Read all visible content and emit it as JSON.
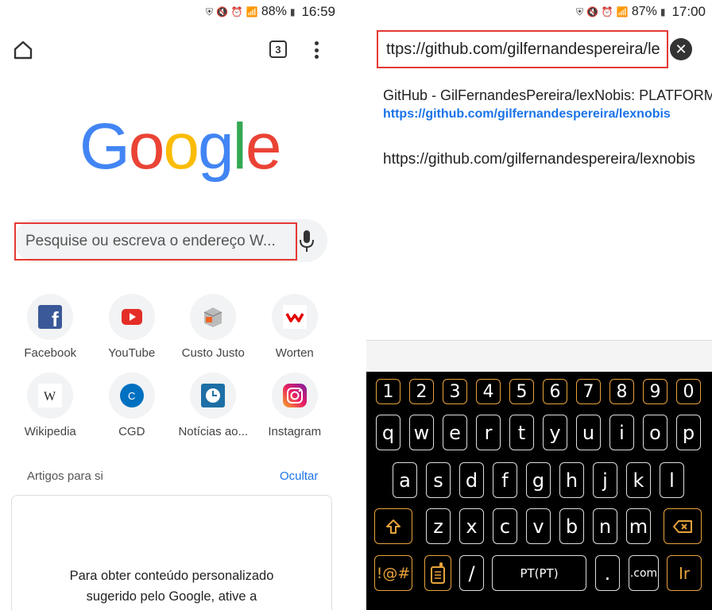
{
  "left": {
    "status": {
      "battery": "88%",
      "time": "16:59"
    },
    "tab_count": "3",
    "logo": [
      "G",
      "o",
      "o",
      "g",
      "l",
      "e"
    ],
    "logo_colors": [
      "#4285F4",
      "#EA4335",
      "#FBBC05",
      "#4285F4",
      "#34A853",
      "#EA4335"
    ],
    "search": {
      "placeholder": "Pesquise ou escreva o endereço W..."
    },
    "shortcuts": [
      {
        "label": "Facebook",
        "icon": "facebook-icon"
      },
      {
        "label": "YouTube",
        "icon": "youtube-icon"
      },
      {
        "label": "Custo Justo",
        "icon": "custo-justo-icon"
      },
      {
        "label": "Worten",
        "icon": "worten-icon"
      },
      {
        "label": "Wikipedia",
        "icon": "wikipedia-icon"
      },
      {
        "label": "CGD",
        "icon": "cgd-icon"
      },
      {
        "label": "Notícias ao...",
        "icon": "clock-icon"
      },
      {
        "label": "Instagram",
        "icon": "instagram-icon"
      }
    ],
    "articles_label": "Artigos para si",
    "hide_label": "Ocultar",
    "card_text_1": "Para obter conteúdo personalizado",
    "card_text_2": "sugerido pelo Google, ative a"
  },
  "right": {
    "status": {
      "battery": "87%",
      "time": "17:00"
    },
    "url_value": "ttps://github.com/gilfernandespereira/le",
    "suggestion_title": "GitHub - GilFernandesPereira/lexNobis: PLATFORM",
    "suggestion_url": "https://github.com/gilfernandespereira/lexnobis",
    "suggestion_plain": "https://github.com/gilfernandespereira/lexnobis",
    "keyboard": {
      "row_numbers": [
        "1",
        "2",
        "3",
        "4",
        "5",
        "6",
        "7",
        "8",
        "9",
        "0"
      ],
      "row1": [
        "q",
        "w",
        "e",
        "r",
        "t",
        "y",
        "u",
        "i",
        "o",
        "p"
      ],
      "row2": [
        "a",
        "s",
        "d",
        "f",
        "g",
        "h",
        "j",
        "k",
        "l"
      ],
      "row3": [
        "z",
        "x",
        "c",
        "v",
        "b",
        "n",
        "m"
      ],
      "symbols": "!@#",
      "slash": "/",
      "space": "PT(PT)",
      "period": ".",
      "dotcom": ".com",
      "enter": "Ir"
    }
  }
}
